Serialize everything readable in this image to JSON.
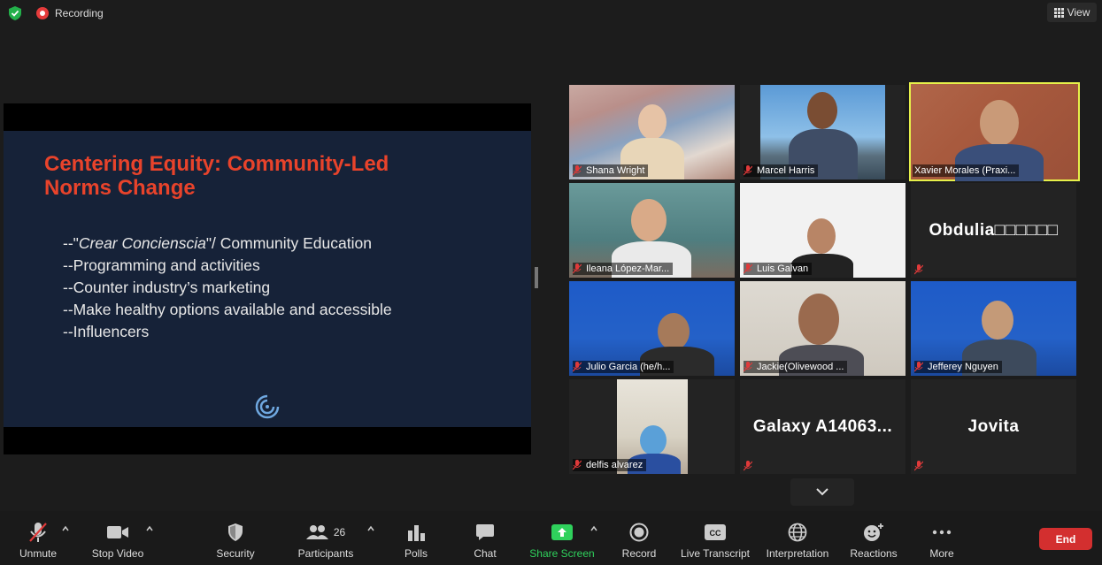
{
  "topbar": {
    "recording_label": "Recording",
    "view_label": "View"
  },
  "slide": {
    "title_line1": "Centering Equity: Community-Led",
    "title_line2": "Norms Change",
    "bullet1_prefix": "--\"",
    "bullet1_em": "Crear Concienscia",
    "bullet1_suffix": "\"/ Community Education",
    "bullet2": "--Programming and activities",
    "bullet3": "--Counter industry’s marketing",
    "bullet4": "--Make healthy options available and accessible",
    "bullet5": "--Influencers",
    "title_color": "#e8432b",
    "background_color": "#162238"
  },
  "participants": [
    {
      "name": "Shana Wright",
      "muted": true
    },
    {
      "name": "Marcel Harris",
      "muted": true
    },
    {
      "name": "Xavier Morales (Praxi...",
      "muted": false,
      "active_speaker": true
    },
    {
      "name": "Ileana López-Mar...",
      "muted": true
    },
    {
      "name": "Luis Galvan",
      "muted": true
    },
    {
      "name": "Obdulia□□□□□□",
      "muted": true,
      "video_off": true
    },
    {
      "name": "Julio Garcia (he/h...",
      "muted": true
    },
    {
      "name": "Jackie(Olivewood ...",
      "muted": true
    },
    {
      "name": "Jefferey Nguyen",
      "muted": true
    },
    {
      "name": "delfis alvarez",
      "muted": true
    },
    {
      "name": "Galaxy  A14063...",
      "muted": true,
      "video_off": true
    },
    {
      "name": "Jovita",
      "muted": true,
      "video_off": true
    }
  ],
  "toolbar": {
    "unmute": "Unmute",
    "stop_video": "Stop Video",
    "security": "Security",
    "participants": "Participants",
    "participants_count": "26",
    "polls": "Polls",
    "chat": "Chat",
    "share_screen": "Share Screen",
    "record": "Record",
    "live_transcript": "Live Transcript",
    "interpretation": "Interpretation",
    "reactions": "Reactions",
    "more": "More",
    "end": "End",
    "share_color": "#2fd15c",
    "end_color": "#d32f2f"
  }
}
